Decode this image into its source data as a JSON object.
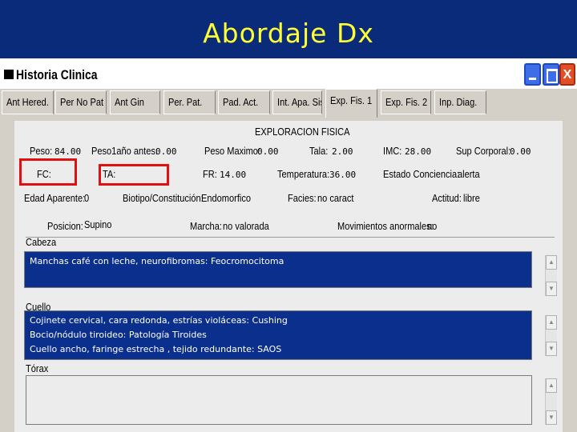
{
  "slide": {
    "title": "Abordaje  Dx"
  },
  "window": {
    "title": "Historia Clinica",
    "buttons": {
      "minimize": "_",
      "maximize": "□",
      "close": "X"
    }
  },
  "tabs": [
    {
      "label": "Ant Hered."
    },
    {
      "label": "Per No Pat"
    },
    {
      "label": "Ant Gin"
    },
    {
      "label": "Per. Pat."
    },
    {
      "label": "Pad. Act."
    },
    {
      "label": "Int. Apa. Sis"
    },
    {
      "label": "Exp. Fis. 1",
      "active": true
    },
    {
      "label": "Exp. Fis. 2"
    },
    {
      "label": "Inp. Diag."
    }
  ],
  "form": {
    "section_title": "EXPLORACION FISICA",
    "peso_label": "Peso:",
    "peso": "84.00",
    "peso_ano_label": "Peso1año antes:",
    "peso_ano": "0.00",
    "peso_max_label": "Peso Maximo:",
    "peso_max": "0.00",
    "talla_label": "Tala:",
    "talla": "2.00",
    "imc_label": "IMC:",
    "imc": "28.00",
    "sup_label": "Sup Corporal:",
    "sup": "0.00",
    "fc_label": "FC:",
    "ta_label": "TA:",
    "fr_label": "FR:",
    "fr": "14.00",
    "temp_label": "Temperatura:",
    "temp": "36.00",
    "conciencia_label": "Estado Conciencia:",
    "conciencia": "alerta",
    "edad_label": "Edad Aparente:",
    "edad": "0",
    "biotipo_label": "Biotipo/Constitución:",
    "biotipo": "Endomorfico",
    "facies_label": "Facies:",
    "facies": "no caract",
    "actitud_label": "Actitud:",
    "actitud": "libre",
    "posicion_label": "Posicion:",
    "posicion": "Supino",
    "marcha_label": "Marcha:",
    "marcha": "no valorada",
    "movimientos_label": "Movimientos anormales:",
    "movimientos": "no",
    "cabeza_label": "Cabeza",
    "cabeza_text": "Manchas café  con leche,  neurofibromas: Feocromocitoma",
    "cuello_label": "Cuello",
    "cuello_lines": [
      "Cojinete cervical,  cara redonda, estrías  violáceas: Cushing",
      "Bocio/nódulo  tiroideo: Patología Tiroides",
      "Cuello ancho, faringe estrecha , tejido redundante: SAOS"
    ],
    "torax_label": "Tórax"
  }
}
